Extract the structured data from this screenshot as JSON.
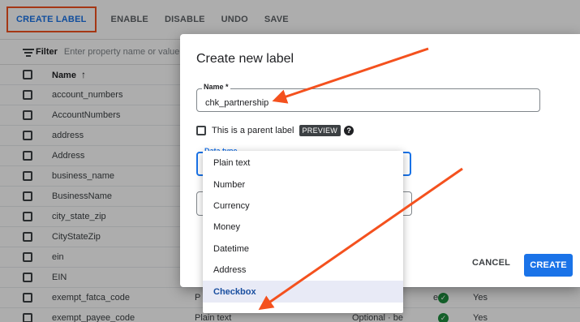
{
  "toolbar": {
    "create_label": "CREATE LABEL",
    "enable": "ENABLE",
    "disable": "DISABLE",
    "undo": "UNDO",
    "save": "SAVE"
  },
  "filter": {
    "label": "Filter",
    "placeholder": "Enter property name or value"
  },
  "table": {
    "header": {
      "name": "Name",
      "sort_icon": "arrow-up-icon"
    },
    "rows": [
      {
        "name": "account_numbers"
      },
      {
        "name": "AccountNumbers"
      },
      {
        "name": "address"
      },
      {
        "name": "Address"
      },
      {
        "name": "business_name"
      },
      {
        "name": "BusinessName"
      },
      {
        "name": "city_state_zip"
      },
      {
        "name": "CityStateZip"
      },
      {
        "name": "ein"
      },
      {
        "name": "EIN"
      },
      {
        "name": "exempt_fatca_code",
        "type": "P",
        "req": "e",
        "enabled": "Yes"
      },
      {
        "name": "exempt_payee_code",
        "type": "Plain text",
        "req": "Optional · be",
        "enabled": "Yes"
      }
    ]
  },
  "dialog": {
    "title": "Create new label",
    "name_field": {
      "label": "Name *",
      "value": "chk_partnership"
    },
    "parent_checkbox_label": "This is a parent label",
    "preview_badge": "PREVIEW",
    "help_icon": "help-icon",
    "data_type_field": {
      "label": "Data type"
    },
    "cancel": "CANCEL",
    "create": "CREATE"
  },
  "data_type_menu": {
    "options": [
      "Plain text",
      "Number",
      "Currency",
      "Money",
      "Datetime",
      "Address",
      "Checkbox"
    ],
    "selected": "Checkbox"
  },
  "colors": {
    "accent": "#1a73e8",
    "annotation": "#f4511e",
    "success": "#1e8e3e"
  }
}
